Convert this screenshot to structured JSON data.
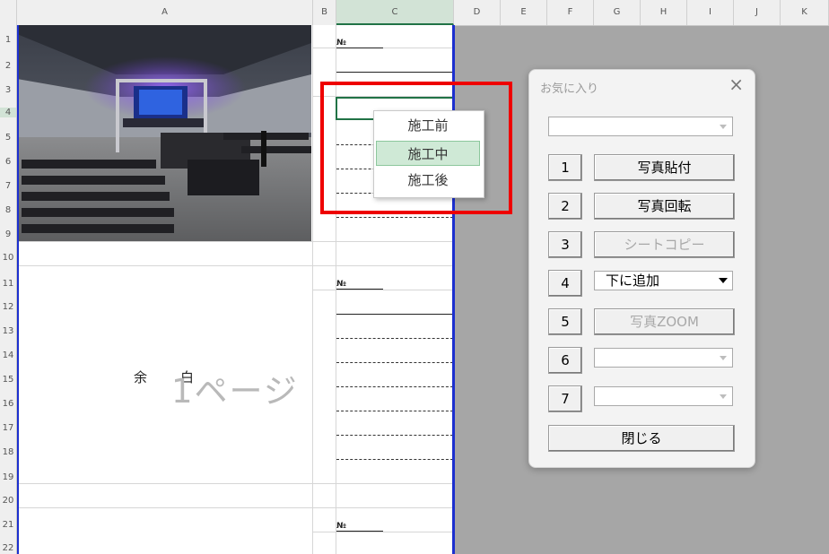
{
  "columns": [
    "A",
    "B",
    "C",
    "D",
    "E",
    "F",
    "G",
    "H",
    "I",
    "J",
    "K"
  ],
  "rows": [
    "1",
    "2",
    "3",
    "4",
    "5",
    "6",
    "7",
    "8",
    "9",
    "10",
    "11",
    "12",
    "13",
    "14",
    "15",
    "16",
    "17",
    "18",
    "19",
    "20",
    "21",
    "22"
  ],
  "sheet": {
    "no_label": "№",
    "margin_text_left": "余",
    "margin_text_right": "白",
    "page_watermark": "1ページ"
  },
  "dropdown": {
    "items": [
      "施工前",
      "施工中",
      "施工後"
    ],
    "selected": "施工中"
  },
  "dialog": {
    "title": "お気に入り",
    "close_icon": "close-icon",
    "top_combo_value": "",
    "buttons": [
      {
        "num": "1",
        "label": "写真貼付",
        "enabled": true
      },
      {
        "num": "2",
        "label": "写真回転",
        "enabled": true
      },
      {
        "num": "3",
        "label": "シートコピー",
        "enabled": false
      },
      {
        "num": "4",
        "label": "下に追加",
        "enabled": true
      },
      {
        "num": "5",
        "label": "写真ZOOM",
        "enabled": false
      },
      {
        "num": "6",
        "label": "",
        "enabled": false
      },
      {
        "num": "7",
        "label": "",
        "enabled": false
      }
    ],
    "close_button": "閉じる"
  },
  "colors": {
    "highlight": "#ee0000",
    "page_border": "#1c2fcf",
    "selection": "#217346"
  }
}
